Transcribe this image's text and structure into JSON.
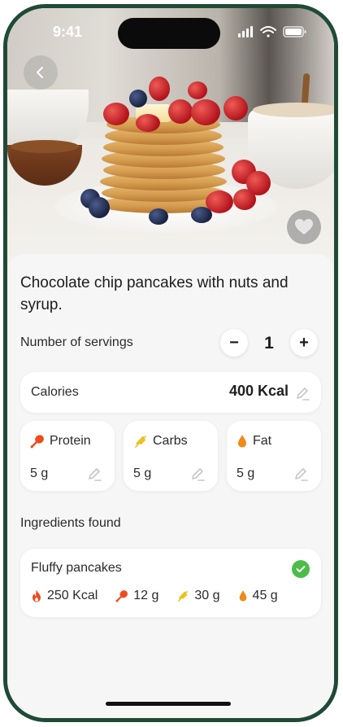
{
  "status_bar": {
    "time": "9:41"
  },
  "recipe": {
    "title": "Chocolate chip pancakes with nuts and syrup."
  },
  "servings": {
    "label": "Number of servings",
    "value": "1",
    "minus": "−",
    "plus": "+"
  },
  "calories": {
    "label": "Calories",
    "value": "400 Kcal"
  },
  "macros": [
    {
      "name": "Protein",
      "value": "5 g",
      "icon": "drumstick-icon",
      "color": "#f04a1c"
    },
    {
      "name": "Carbs",
      "value": "5 g",
      "icon": "wheat-icon",
      "color": "#e8c21c"
    },
    {
      "name": "Fat",
      "value": "5 g",
      "icon": "droplet-icon",
      "color": "#f08a18"
    }
  ],
  "ingredients": {
    "title": "Ingredients found",
    "items": [
      {
        "name": "Fluffy pancakes",
        "kcal": "250 Kcal",
        "protein": "12 g",
        "carbs": "30 g",
        "fat": "45 g",
        "checked": true
      }
    ]
  },
  "colors": {
    "accent_green": "#4cbc4a",
    "frame": "#1f4a36",
    "flame": "#f04a1c"
  }
}
